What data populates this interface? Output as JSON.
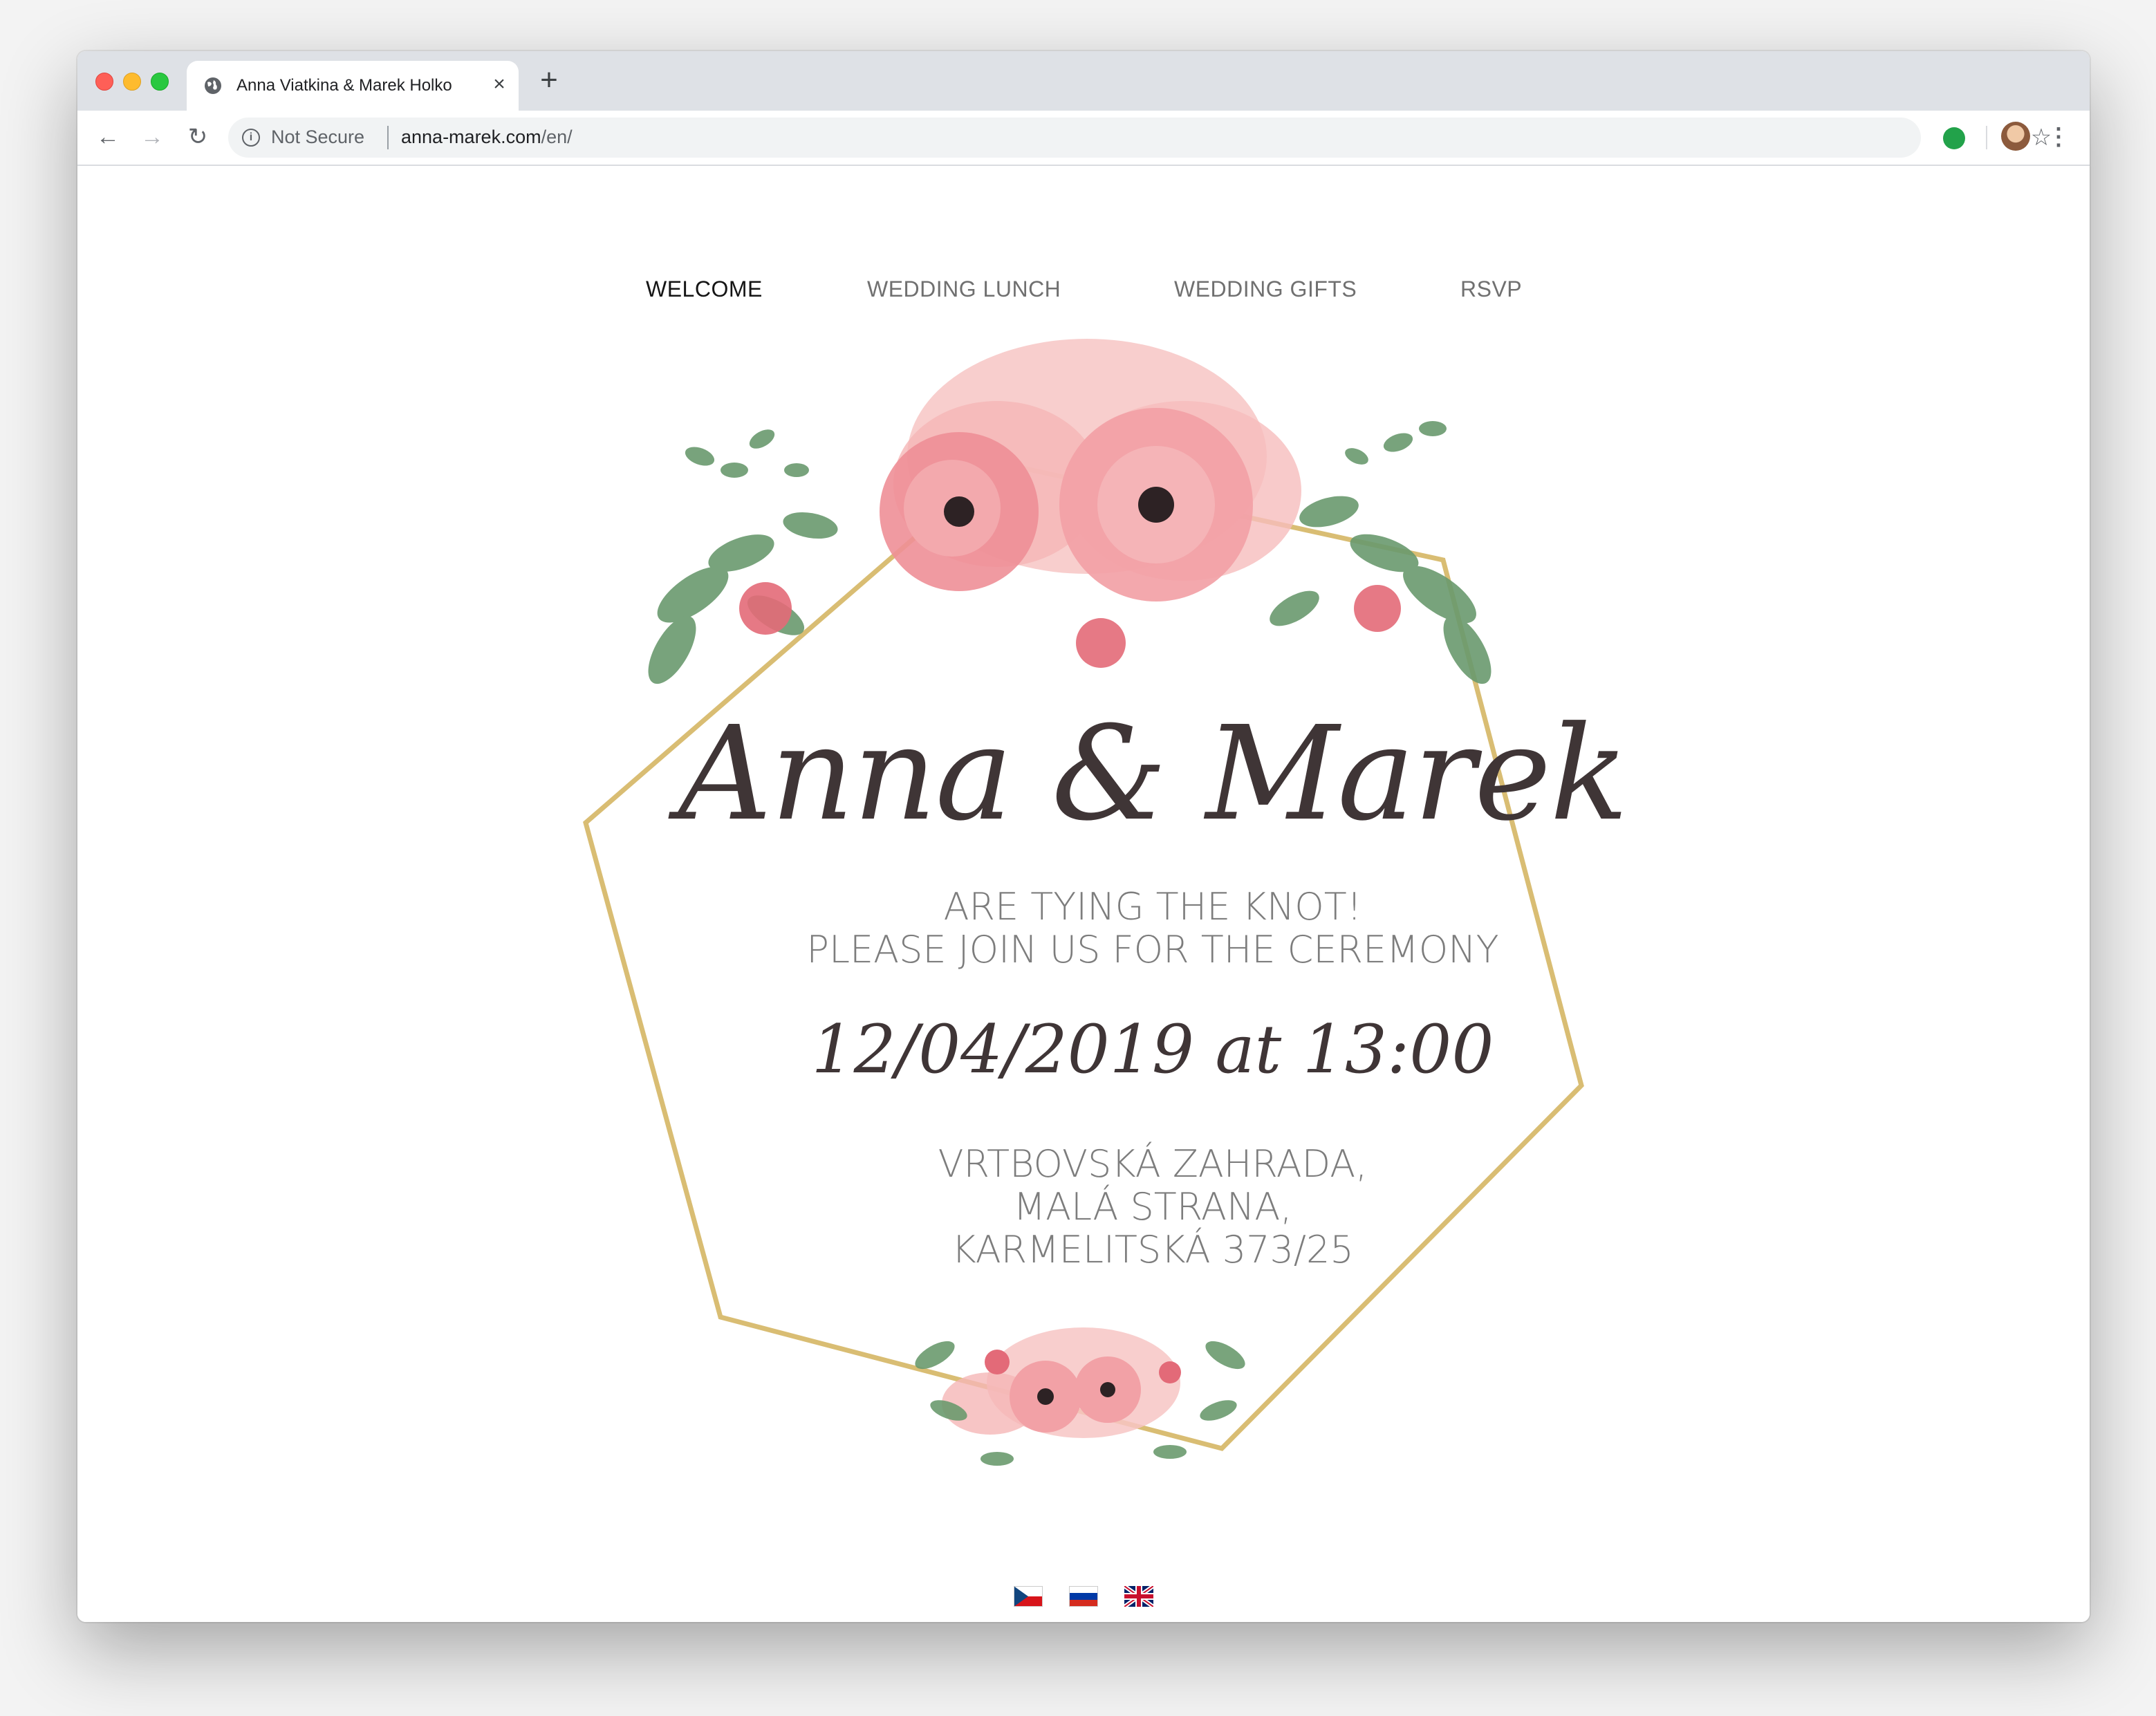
{
  "browser": {
    "tab_title": "Anna Viatkina & Marek Holko",
    "tab_close": "×",
    "new_tab": "+",
    "security_label": "Not Secure",
    "url_host": "anna-marek.com",
    "url_path": "/en/",
    "icons": [
      "globe-icon",
      "back-arrow-icon",
      "forward-arrow-icon",
      "reload-icon",
      "info-icon",
      "star-icon",
      "extension-icon",
      "profile-avatar",
      "more-menu-icon"
    ]
  },
  "site_nav": {
    "items": [
      {
        "label": "WELCOME",
        "active": true
      },
      {
        "label": "WEDDING LUNCH",
        "active": false
      },
      {
        "label": "WEDDING GIFTS",
        "active": false
      },
      {
        "label": "RSVP",
        "active": false
      }
    ]
  },
  "invitation": {
    "names": "Anna & Marek",
    "line1": "ARE TYING THE KNOT!",
    "line2": "PLEASE JOIN US FOR THE CEREMONY",
    "datetime": "12/04/2019 at 13:00",
    "address": [
      "VRTBOVSKÁ ZAHRADA,",
      "MALÁ STRANA,",
      "KARMELITSKÁ 373/25"
    ]
  },
  "languages": [
    "Czech flag",
    "Russian flag",
    "UK flag"
  ],
  "colors": {
    "frame_gold": "#d9bd73",
    "petal_pink": "#f2a3a8",
    "leaf_green": "#5f8f64",
    "text_dark": "#3f3536",
    "text_grey": "#7d7d7d"
  }
}
